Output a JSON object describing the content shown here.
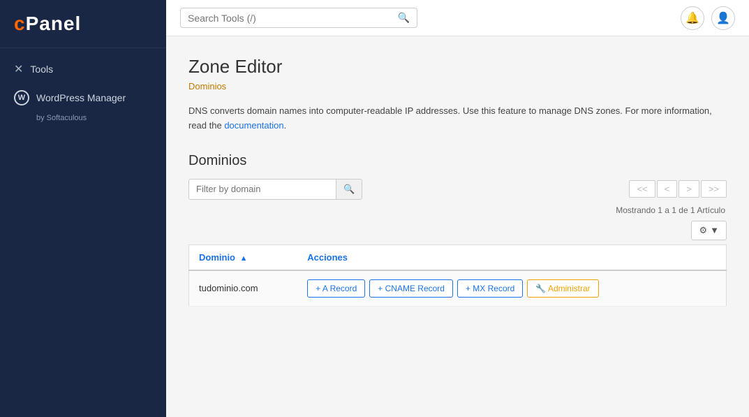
{
  "sidebar": {
    "logo": "cPanel",
    "items": [
      {
        "id": "tools",
        "label": "Tools",
        "icon": "✕"
      },
      {
        "id": "wordpress",
        "label": "WordPress Manager",
        "sub": "by Softaculous",
        "icon": "W"
      }
    ]
  },
  "header": {
    "search_placeholder": "Search Tools (/)",
    "search_label": "Search Tools (/)"
  },
  "page": {
    "title": "Zone Editor",
    "breadcrumb": "Dominios",
    "description_plain": "DNS converts domain names into computer-readable IP addresses. ",
    "description_link_text": "Use this feature to manage DNS zones. For more information, read the",
    "description_doc_link": "documentation",
    "description_end": ".",
    "section_title": "Dominios",
    "filter_placeholder": "Filter by domain",
    "showing_text": "Mostrando 1 a 1 de 1 Artículo",
    "gear_label": "⚙",
    "table": {
      "col_domain": "Dominio",
      "col_actions": "Acciones",
      "sort_arrow": "▲",
      "rows": [
        {
          "domain": "tudominio.com",
          "btn_a": "+ A Record",
          "btn_cname": "+ CNAME Record",
          "btn_mx": "+ MX Record",
          "btn_manage": "🔧 Administrar"
        }
      ]
    },
    "pagination": {
      "first": "<<",
      "prev": "<",
      "next": ">",
      "last": ">>"
    }
  }
}
